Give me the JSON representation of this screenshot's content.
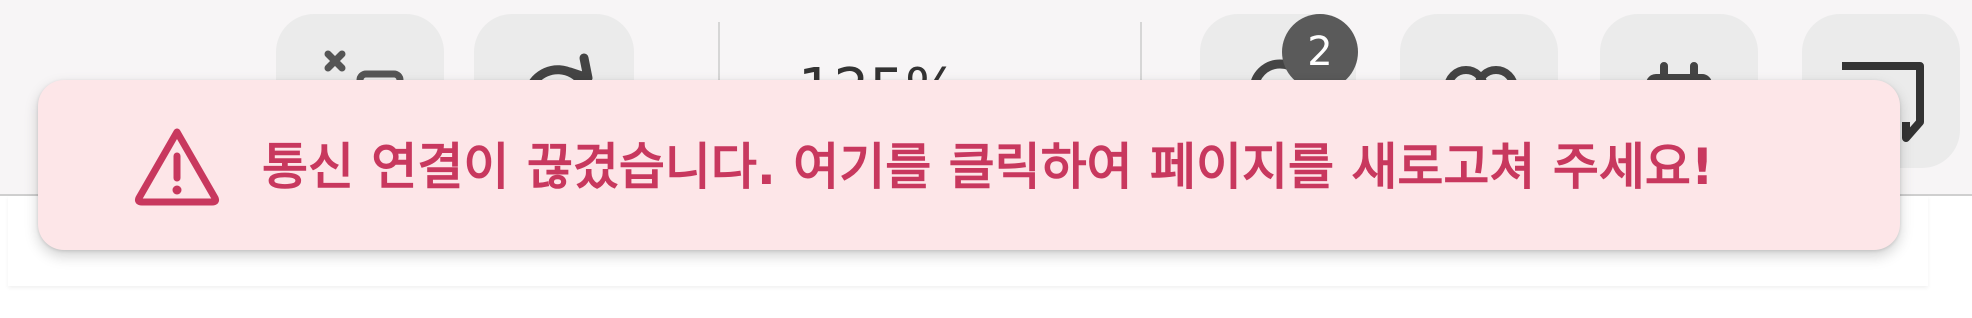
{
  "toolbar": {
    "zoom_level": "125%",
    "notification_count": "2",
    "icons": [
      "collapse-icon",
      "refresh-icon",
      "notifications-icon",
      "chat-icon",
      "calendar-icon",
      "memo-icon"
    ]
  },
  "banner": {
    "message": "통신 연결이 끊겼습니다. 여기를 클릭하여 페이지를 새로고쳐 주세요!",
    "icon": "warning-icon",
    "text_color": "#c8385e",
    "background_color": "#fde6e8"
  }
}
